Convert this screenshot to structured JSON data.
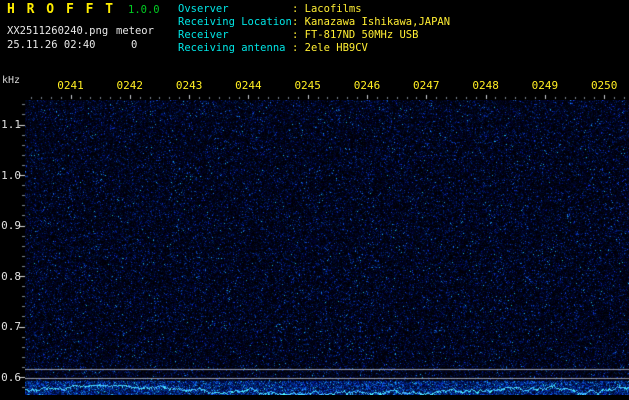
{
  "header": {
    "app_name": "H R O F F T",
    "version": "1.0.0",
    "filename": "XX2511260240.png",
    "mode": "meteor",
    "count": "0",
    "datetime": "25.11.26 02:40",
    "separator": ": ",
    "info": [
      {
        "label": "Ovserver",
        "value": "Lacofilms"
      },
      {
        "label": "Receiving Location",
        "value": "Kanazawa Ishikawa,JAPAN"
      },
      {
        "label": "Receiver",
        "value": "FT-817ND 50MHz USB"
      },
      {
        "label": "Receiving antenna",
        "value": "2ele HB9CV"
      }
    ]
  },
  "chart": {
    "unit_label": "kHz",
    "x_ticks": [
      "0241",
      "0242",
      "0243",
      "0244",
      "0245",
      "0246",
      "0247",
      "0248",
      "0249",
      "0250"
    ],
    "y_ticks": [
      "1.1",
      "1.0",
      "0.9",
      "0.8",
      "0.7",
      "0.6"
    ]
  },
  "chart_data": {
    "type": "heatmap",
    "title": "HROFFT radio meteor spectrogram",
    "xlabel": "",
    "ylabel": "kHz",
    "x_ticks": [
      "0241",
      "0242",
      "0243",
      "0244",
      "0245",
      "0246",
      "0247",
      "0248",
      "0249",
      "0250"
    ],
    "y_ticks": [
      1.1,
      1.0,
      0.9,
      0.8,
      0.7,
      0.6
    ],
    "ylim": [
      0.58,
      1.15
    ],
    "content": "uniform dark-blue background radio noise speckle; no meteor echo traces; meteor count shown is 0",
    "horizontal_lines_khz": [
      0.62,
      0.6
    ],
    "bottom_band": "brighter noise strip below 0.6 kHz with jagged cyan signal-level trace"
  },
  "colors": {
    "background": "#000000",
    "title_yellow": "#ffee00",
    "version_green": "#00cc22",
    "label_cyan": "#00e5e5",
    "value_yellow": "#ffee33",
    "axis_white": "#e0e0e0",
    "noise_base": "#000014",
    "noise_speckle": "#2233cc",
    "level_trace_cyan": "#55ccff",
    "reference_line_gray": "#c8cdd7"
  }
}
